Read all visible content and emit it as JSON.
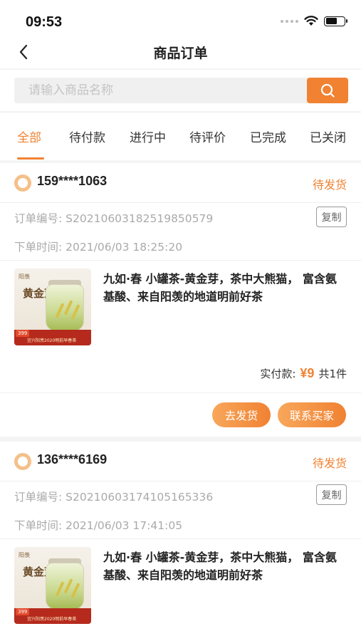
{
  "status_bar": {
    "time": "09:53"
  },
  "navbar": {
    "title": "商品订单"
  },
  "search": {
    "placeholder": "请输入商品名称",
    "value": ""
  },
  "tabs": [
    {
      "label": "全部",
      "active": true
    },
    {
      "label": "待付款",
      "active": false
    },
    {
      "label": "进行中",
      "active": false
    },
    {
      "label": "待评价",
      "active": false
    },
    {
      "label": "已完成",
      "active": false
    },
    {
      "label": "已关闭",
      "active": false
    }
  ],
  "labels": {
    "order_no": "订单编号:",
    "order_time": "下单时间:",
    "copy": "复制",
    "paid": "实付款:",
    "ship_button": "去发货",
    "contact_button": "联系买家"
  },
  "orders": [
    {
      "buyer": "159****1063",
      "status": "待发货",
      "order_no": "S20210603182519850579",
      "order_time": "2021/06/03 18:25:20",
      "product": {
        "name": "九如·春 小罐茶-黄金芽，茶中大熊猫， 富含氨基酸、来自阳羡的地道明前好茶",
        "thumb_texts": {
          "brand": "阳羡",
          "title": "黄金芽",
          "price": "399",
          "footer": "宜兴阳羡2020明前早春茶"
        }
      },
      "amount": "¥9",
      "count": "共1件"
    },
    {
      "buyer": "136****6169",
      "status": "待发货",
      "order_no": "S20210603174105165336",
      "order_time": "2021/06/03 17:41:05",
      "product": {
        "name": "九如·春 小罐茶-黄金芽，茶中大熊猫， 富含氨基酸、来自阳羡的地道明前好茶",
        "thumb_texts": {
          "brand": "阳羡",
          "title": "黄金芽",
          "price": "399",
          "footer": "宜兴阳羡2020明前早春茶"
        }
      }
    }
  ],
  "colors": {
    "accent": "#f08232",
    "background": "#f4f4f4"
  }
}
